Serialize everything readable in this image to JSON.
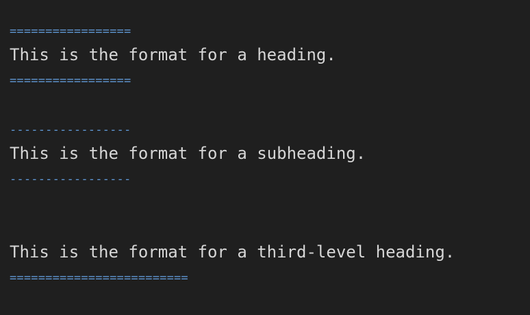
{
  "editor": {
    "lines": {
      "heading_rule_top": "=================",
      "heading_text": "This is the format for a heading.",
      "heading_rule_bottom": "=================",
      "subheading_rule_top": "-----------------",
      "subheading_text": "This is the format for a subheading.",
      "subheading_rule_bottom": "-----------------",
      "third_level_text": "This is the format for a third-level heading.",
      "third_level_rule": "========================="
    }
  },
  "colors": {
    "background": "#1f1f1f",
    "text": "#d6d6d6",
    "markup": "#5f97d4"
  }
}
